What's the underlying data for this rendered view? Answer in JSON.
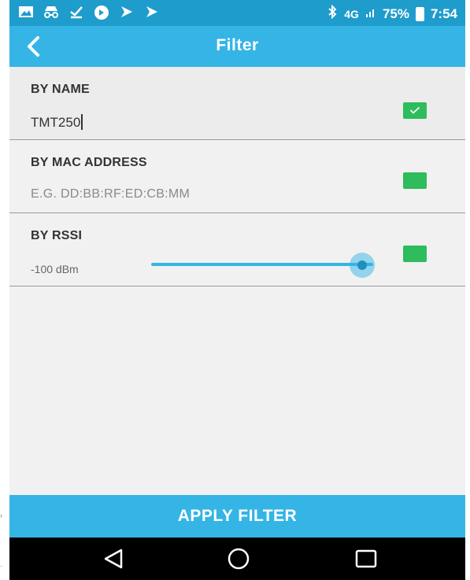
{
  "status_bar": {
    "left_icons": [
      "image-icon",
      "incognito-icon",
      "download-done-icon",
      "circle-arrow-icon",
      "play-tag-icon",
      "play-tag-icon"
    ],
    "bluetooth_icon": "bluetooth-icon",
    "network": "4G",
    "battery_percent": "75%",
    "time": "7:54"
  },
  "app_bar": {
    "title": "Filter"
  },
  "by_name": {
    "label": "BY NAME",
    "value": "TMT250",
    "checked": true
  },
  "by_mac": {
    "label": "BY MAC ADDRESS",
    "placeholder": "E.G. DD:BB:RF:ED:CB:MM",
    "checked": false
  },
  "by_rssi": {
    "label": "BY RSSI",
    "value": "-100 dBm",
    "slider_fraction": 0.95,
    "checked": false
  },
  "apply_button": {
    "label": "APPLY FILTER"
  },
  "colors": {
    "status_bar": "#1e9ccc",
    "app_bar": "#35b5e5",
    "checkbox": "#2ebc5c",
    "nav_bar": "#000000"
  }
}
